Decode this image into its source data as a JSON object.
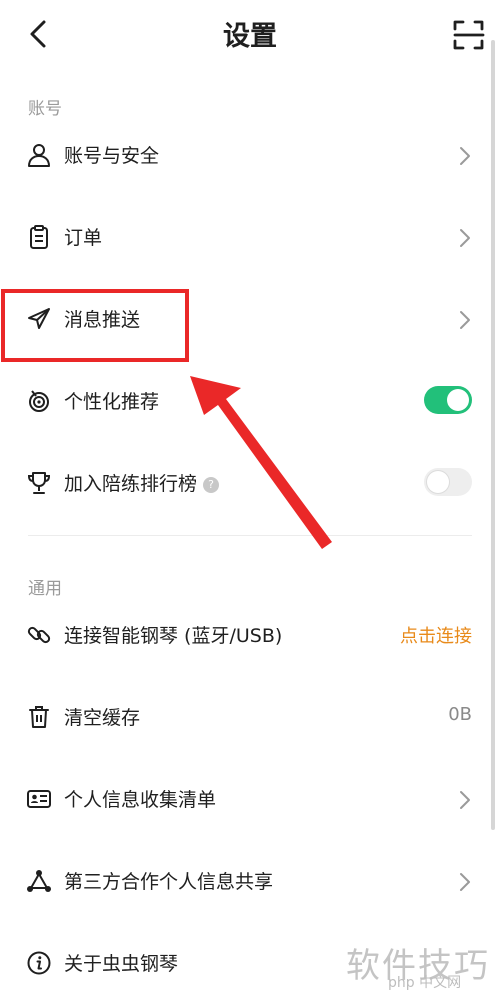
{
  "header": {
    "title": "设置"
  },
  "sections": {
    "account": {
      "label": "账号"
    },
    "general": {
      "label": "通用"
    }
  },
  "rows": {
    "account_security": {
      "label": "账号与安全"
    },
    "orders": {
      "label": "订单"
    },
    "push": {
      "label": "消息推送"
    },
    "personalized": {
      "label": "个性化推荐",
      "enabled": true
    },
    "leaderboard": {
      "label": "加入陪练排行榜",
      "help": "?",
      "enabled": false
    },
    "piano": {
      "label": "连接智能钢琴 (蓝牙/USB)",
      "action": "点击连接"
    },
    "cache": {
      "label": "清空缓存",
      "value": "0B"
    },
    "info_list": {
      "label": "个人信息收集清单"
    },
    "third_party": {
      "label": "第三方合作个人信息共享"
    },
    "about": {
      "label": "关于虫虫钢琴"
    }
  },
  "watermark": {
    "text": "软件技巧",
    "small": "php 中文网"
  },
  "colors": {
    "toggle_on": "#22c07a",
    "action": "#e88a1a",
    "annotation": "#ea2828"
  }
}
